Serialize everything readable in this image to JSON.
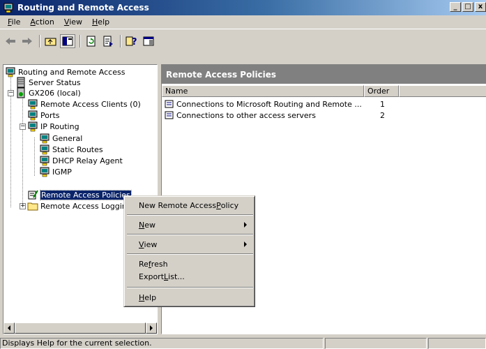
{
  "window": {
    "title": "Routing and Remote Access",
    "minimize": "_",
    "restore": "□",
    "close": "x"
  },
  "menu": [
    {
      "label": "File",
      "ul": "F",
      "rest": "ile"
    },
    {
      "label": "Action",
      "ul": "A",
      "rest": "ction"
    },
    {
      "label": "View",
      "ul": "V",
      "rest": "iew"
    },
    {
      "label": "Help",
      "ul": "H",
      "rest": "elp"
    }
  ],
  "toolbar": {
    "icons": [
      "back-arrow-icon",
      "forward-arrow-icon",
      "up-folder-icon",
      "show-hide-console-tree-icon",
      "refresh-icon",
      "export-list-icon",
      "help-icon",
      "properties-pane-icon"
    ]
  },
  "tree": {
    "root": "Routing and Remote Access",
    "server_status": "Server Status",
    "server": "GX206 (local)",
    "remote_access_clients": "Remote Access Clients (0)",
    "ports": "Ports",
    "ip_routing": "IP Routing",
    "general": "General",
    "static_routes": "Static Routes",
    "dhcp_relay": "DHCP Relay Agent",
    "igmp": "IGMP",
    "remote_access_policies": "Remote Access Policies",
    "remote_access_logging": "Remote Access Logging"
  },
  "right_pane": {
    "title": "Remote Access Policies",
    "columns": {
      "name": "Name",
      "order": "Order"
    },
    "rows": [
      {
        "name": "Connections to Microsoft Routing and Remote ...",
        "order": "1"
      },
      {
        "name": "Connections to other access servers",
        "order": "2"
      }
    ]
  },
  "context_menu": {
    "new_policy": {
      "pre": "New Remote Access ",
      "ul": "P",
      "post": "olicy"
    },
    "new": {
      "pre": "",
      "ul": "N",
      "post": "ew"
    },
    "view": {
      "pre": "",
      "ul": "V",
      "post": "iew"
    },
    "refresh": {
      "pre": "Re",
      "ul": "f",
      "post": "resh"
    },
    "export": {
      "pre": "Export ",
      "ul": "L",
      "post": "ist..."
    },
    "help": {
      "pre": "",
      "ul": "H",
      "post": "elp"
    }
  },
  "status": {
    "text": "Displays Help for the current selection."
  },
  "colors": {
    "title_start": "#0a246a",
    "title_end": "#a6caf0",
    "selection": "#0a246a",
    "pane_header": "#808080"
  }
}
